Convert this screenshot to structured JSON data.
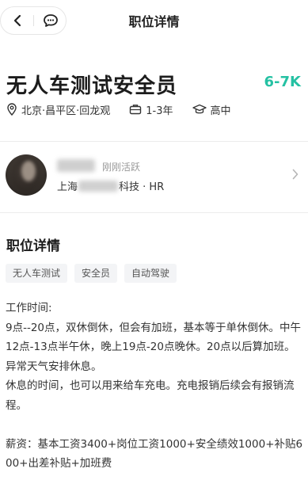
{
  "nav": {
    "title": "职位详情"
  },
  "job": {
    "title": "无人车测试安全员",
    "salary": "6-7K",
    "location": "北京·昌平区·回龙观",
    "experience": "1-3年",
    "education": "高中"
  },
  "recruiter": {
    "status": "刚刚活跃",
    "company_prefix": "上海",
    "company_suffix": "科技 · HR"
  },
  "detail": {
    "section_title": "职位详情",
    "tags": [
      "无人车测试",
      "安全员",
      "自动驾驶"
    ],
    "lines": [
      "工作时间:",
      "9点--20点，双休倒休，但会有加班，基本等于单休倒休。中午12点-13点半午休，晚上19点-20点晚休。20点以后算加班。异常天气安排休息。",
      "休息的时间，也可以用来给车充电。充电报销后续会有报销流程。",
      "",
      "薪资：基本工资3400+岗位工资1000+安全绩效1000+补贴600+出差补贴+加班费"
    ]
  },
  "colors": {
    "salary": "#25c1a3"
  },
  "icons": [
    "back-arrow-icon",
    "message-icon",
    "location-icon",
    "briefcase-icon",
    "education-cap-icon",
    "chevron-right-icon"
  ]
}
